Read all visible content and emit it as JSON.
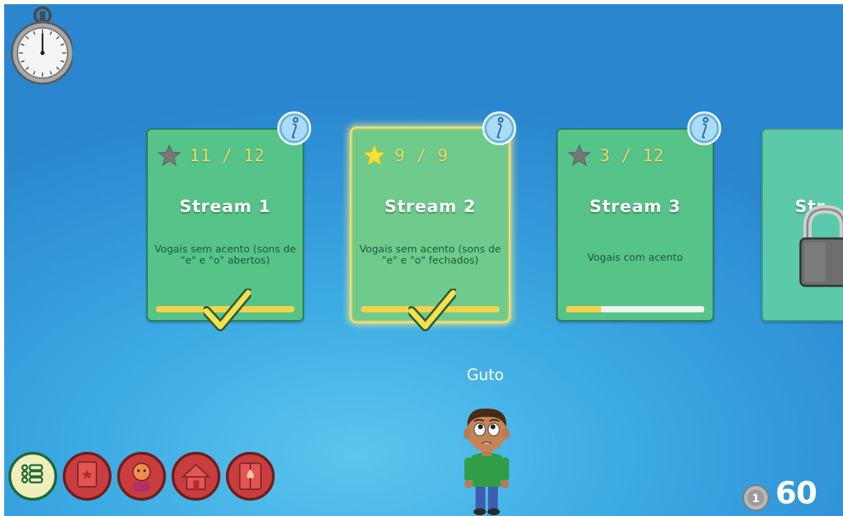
{
  "streams": [
    {
      "title": "Stream 1",
      "stars": "11 / 12",
      "description": "Vogais sem acento (sons de \"e\" e \"o\" abertos)",
      "progress": 1.0,
      "completed": true,
      "star_color": "#777777"
    },
    {
      "title": "Stream 2",
      "stars": "9 / 9",
      "description": "Vogais sem acento (sons de \"e\" e \"o\" fechados)",
      "progress": 1.0,
      "completed": true,
      "star_color": "#f5e03c"
    },
    {
      "title": "Stream 3",
      "stars": "3 / 12",
      "description": "Vogais com acento",
      "progress": 0.25,
      "completed": false,
      "star_color": "#777777"
    },
    {
      "title": "Str",
      "locked": true
    }
  ],
  "character": {
    "name": "Guto"
  },
  "coins": {
    "count": "60",
    "coin_label": "1"
  },
  "menu": [
    "list-icon",
    "book-icon",
    "avatar-icon",
    "house-icon",
    "wardrobe-icon"
  ],
  "icons": {
    "info": "info-icon",
    "lock": "lock-icon",
    "stopwatch": "stopwatch-icon",
    "checkmark": "checkmark-icon"
  }
}
